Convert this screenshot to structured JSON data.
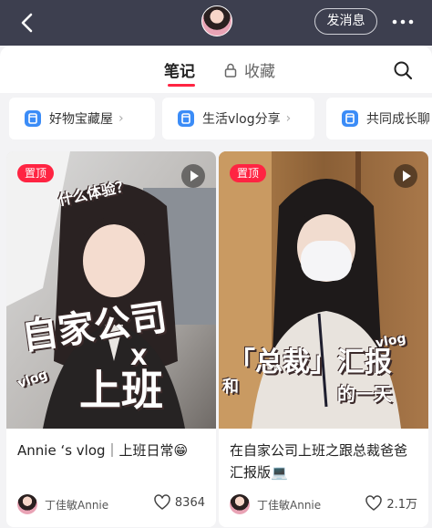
{
  "header": {
    "send_label": "发消息"
  },
  "tabs": {
    "notes_label": "笔记",
    "favorites_label": "收藏"
  },
  "collections": [
    {
      "label": "好物宝藏屋"
    },
    {
      "label": "生活vlog分享"
    },
    {
      "label": "共同成长聊"
    }
  ],
  "notes": [
    {
      "pin_label": "置顶",
      "cover_text_top": "什么体验？",
      "cover_text_main": "自家公司",
      "cover_text_x": "X",
      "cover_text_bottom": "上班",
      "cover_text_vlog": "vlog",
      "title": "Annie ‘s vlog｜上班日常😁",
      "author": "丁佳敏Annie",
      "likes": "8364"
    },
    {
      "pin_label": "置顶",
      "cover_text_vlog": "vlog",
      "cover_text_main": "「总裁」汇报",
      "cover_text_sub": "和",
      "cover_text_bottom": "的一天",
      "title": "在自家公司上班之跟总裁爸爸汇报版💻",
      "author": "丁佳敏Annie",
      "likes": "2.1万"
    }
  ],
  "colors": {
    "accent": "#ff2442",
    "header_bg": "#3d3f4f"
  }
}
